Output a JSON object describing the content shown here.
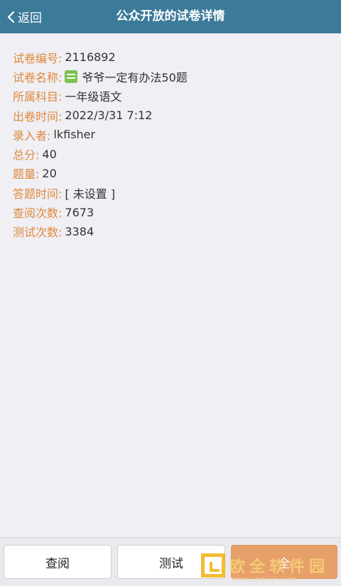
{
  "header": {
    "back_label": "返回",
    "title": "公众开放的试卷详情"
  },
  "details": [
    {
      "label": "试卷编号:",
      "value": "2116892"
    },
    {
      "label": "试卷名称:",
      "value": "爷爷一定有办法50题",
      "icon": "book-icon"
    },
    {
      "label": "所属科目:",
      "value": "一年级语文"
    },
    {
      "label": "出卷时间:",
      "value": "2022/3/31 7:12"
    },
    {
      "label": "录入者:",
      "value": "lkfisher"
    },
    {
      "label": "总分:",
      "value": "40"
    },
    {
      "label": "题量:",
      "value": "20"
    },
    {
      "label": "答题时间:",
      "value": "[ 未设置 ]"
    },
    {
      "label": "查阅次数:",
      "value": "7673"
    },
    {
      "label": "测试次数:",
      "value": "3384"
    }
  ],
  "bottom_bar": {
    "view_label": "查阅",
    "test_label": "测试",
    "third_label": "全"
  },
  "watermark": {
    "text": "欧全软件园",
    "url": "www.apoujin.com"
  }
}
